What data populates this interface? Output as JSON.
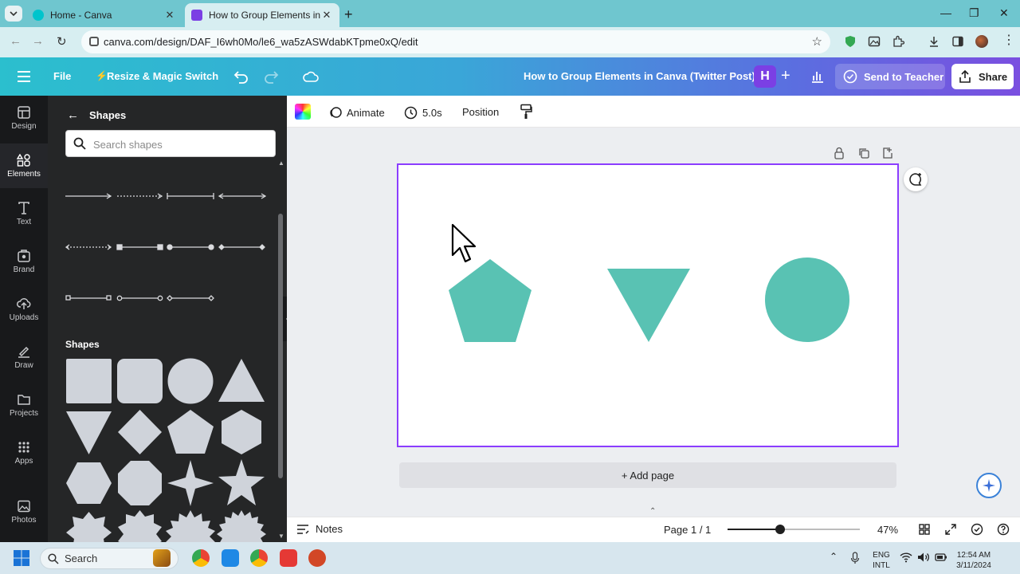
{
  "browser": {
    "tabs": [
      {
        "title": "Home - Canva",
        "active": false
      },
      {
        "title": "How to Group Elements in Canva",
        "active": true
      }
    ],
    "url": "canva.com/design/DAF_I6wh0Mo/le6_wa5zASWdabKTpme0xQ/edit"
  },
  "header": {
    "file_label": "File",
    "resize_label": "Resize & Magic Switch",
    "design_title": "How to Group Elements in Canva (Twitter Post)",
    "avatar_initial": "H",
    "send_label": "Send to Teacher",
    "share_label": "Share"
  },
  "rail": [
    {
      "label": "Design",
      "icon": "design-icon"
    },
    {
      "label": "Elements",
      "icon": "elements-icon",
      "active": true
    },
    {
      "label": "Text",
      "icon": "text-icon"
    },
    {
      "label": "Brand",
      "icon": "brand-icon"
    },
    {
      "label": "Uploads",
      "icon": "upload-icon"
    },
    {
      "label": "Draw",
      "icon": "draw-icon"
    },
    {
      "label": "Projects",
      "icon": "folder-icon"
    },
    {
      "label": "Apps",
      "icon": "apps-icon"
    },
    {
      "label": "Photos",
      "icon": "photo-icon"
    }
  ],
  "panel": {
    "title": "Shapes",
    "search_placeholder": "Search shapes",
    "shapes_heading": "Shapes"
  },
  "editor_toolbar": {
    "animate": "Animate",
    "duration": "5.0s",
    "position": "Position"
  },
  "canvas": {
    "shape_color": "#59c2b3",
    "add_page": "+ Add page"
  },
  "footer": {
    "notes": "Notes",
    "page": "Page 1 / 1",
    "zoom": "47%",
    "zoom_fraction": 0.4
  },
  "taskbar": {
    "search": "Search",
    "lang1": "ENG",
    "lang2": "INTL",
    "time": "12:54 AM",
    "date": "3/11/2024"
  },
  "colors": {
    "accent": "#8b3dff",
    "panel_bg": "#252627",
    "rail_bg": "#18191b"
  }
}
